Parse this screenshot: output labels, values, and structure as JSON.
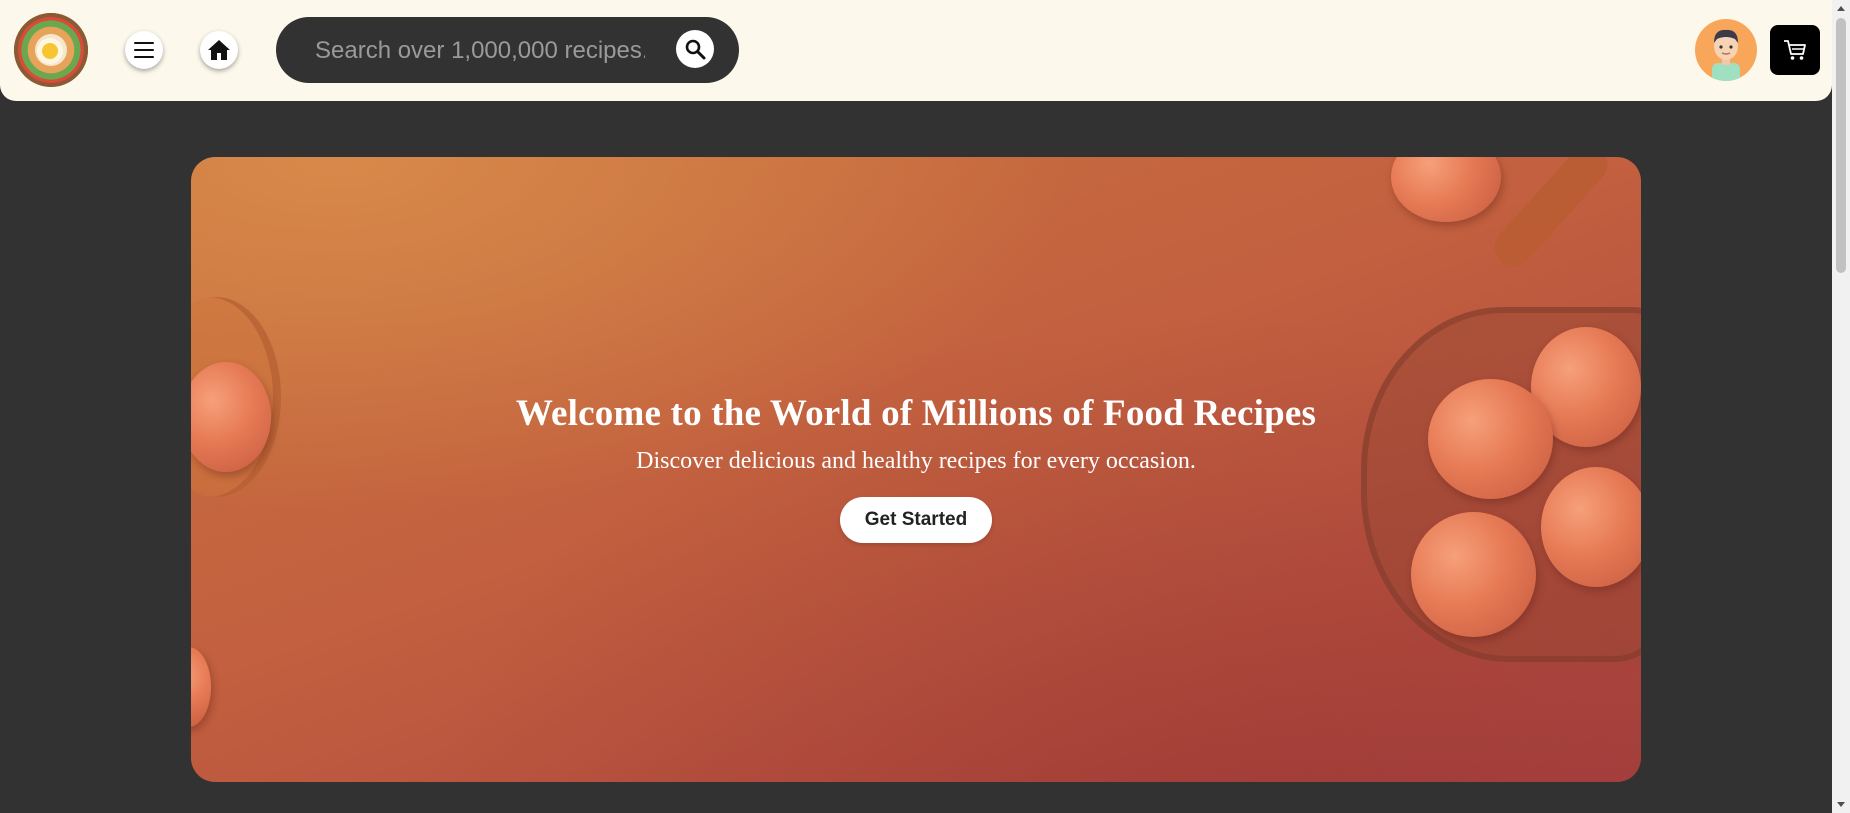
{
  "header": {
    "logo_icon": "food-bowl-logo-icon",
    "menu_icon": "hamburger-menu-icon",
    "home_icon": "home-icon",
    "search": {
      "placeholder": "Search over 1,000,000 recipes...",
      "value": "",
      "button_icon": "magnifier-search-icon"
    },
    "avatar_icon": "user-avatar-icon",
    "cart_icon": "shopping-cart-icon"
  },
  "hero": {
    "title": "Welcome to the World of Millions of Food Recipes",
    "subtitle": "Discover delicious and healthy recipes for every occasion.",
    "cta_label": "Get Started"
  },
  "colors": {
    "header_bg": "#fdf8ec",
    "page_bg": "#323232",
    "search_bg": "#323232",
    "hero_gradient_start": "#c9723e",
    "hero_gradient_end": "#a84240",
    "cart_bg": "#000000",
    "avatar_bg": "#f8a65a"
  }
}
